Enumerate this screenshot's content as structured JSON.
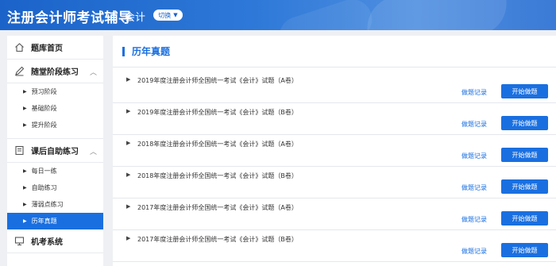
{
  "header": {
    "title": "注册会计师考试辅导",
    "subject": "会计",
    "switch_label": "切换"
  },
  "sidebar": {
    "sections": [
      {
        "label": "题库首页",
        "icon": "home-icon"
      },
      {
        "label": "随堂阶段练习",
        "icon": "pen-icon",
        "items": [
          "预习阶段",
          "基础阶段",
          "提升阶段"
        ]
      },
      {
        "label": "课后自助练习",
        "icon": "book-icon",
        "items": [
          "每日一练",
          "自助练习",
          "薄弱点练习",
          "历年真题"
        ]
      },
      {
        "label": "机考系统",
        "icon": "computer-icon"
      }
    ],
    "active_item": "历年真题"
  },
  "main": {
    "title": "历年真题",
    "record_label": "做题记录",
    "start_label": "开始做题",
    "papers": [
      "2019年度注册会计师全国统一考试《会计》试题（A卷）",
      "2019年度注册会计师全国统一考试《会计》试题（B卷）",
      "2018年度注册会计师全国统一考试《会计》试题（A卷）",
      "2018年度注册会计师全国统一考试《会计》试题（B卷）",
      "2017年度注册会计师全国统一考试《会计》试题（A卷）",
      "2017年度注册会计师全国统一考试《会计》试题（B卷）"
    ]
  },
  "colors": {
    "accent": "#1a6fe0",
    "header": "#2d78d8"
  }
}
